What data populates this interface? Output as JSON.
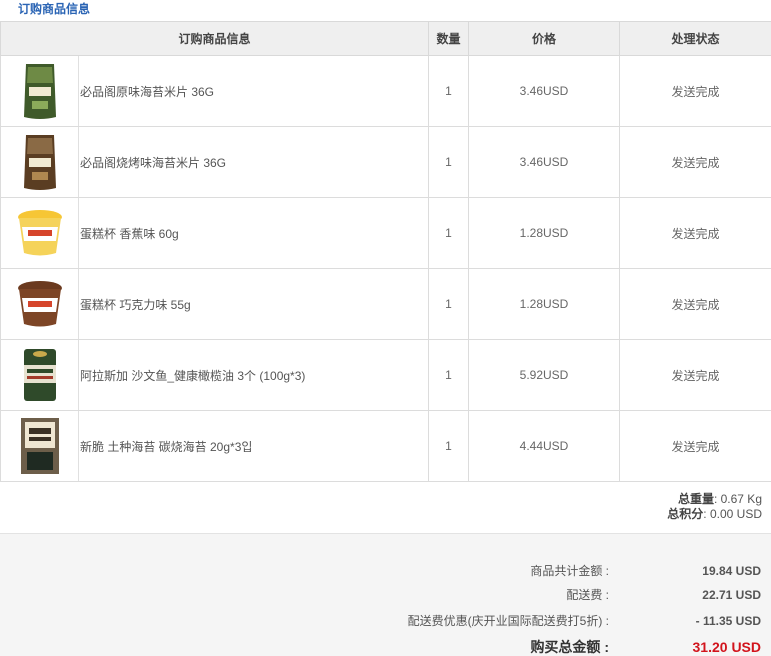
{
  "section_title": "订购商品信息",
  "columns": {
    "product": "订购商品信息",
    "quantity": "数量",
    "price": "价格",
    "status": "处理状态"
  },
  "items": [
    {
      "name": "必品阁原味海苔米片 36G",
      "qty": "1",
      "price": "3.46USD",
      "status": "发送完成",
      "icon": "green-seaweed-snack-bag-icon"
    },
    {
      "name": "必品阁烧烤味海苔米片 36G",
      "qty": "1",
      "price": "3.46USD",
      "status": "发送完成",
      "icon": "brown-seaweed-snack-bag-icon"
    },
    {
      "name": "蛋糕杯 香蕉味 60g",
      "qty": "1",
      "price": "1.28USD",
      "status": "发送完成",
      "icon": "yellow-cake-cup-icon"
    },
    {
      "name": "蛋糕杯 巧克力味 55g",
      "qty": "1",
      "price": "1.28USD",
      "status": "发送完成",
      "icon": "chocolate-cake-cup-icon"
    },
    {
      "name": "阿拉斯加 沙文鱼_健康橄榄油 3个 (100g*3)",
      "qty": "1",
      "price": "5.92USD",
      "status": "发送完成",
      "icon": "salmon-can-icon"
    },
    {
      "name": "新脆 土种海苔 碳烧海苔 20g*3입",
      "qty": "1",
      "price": "4.44USD",
      "status": "发送完成",
      "icon": "laver-pack-icon"
    }
  ],
  "weights": {
    "weight_label": "总重量",
    "weight_value": ": 0.67 Kg",
    "points_label": "总积分",
    "points_value": ": 0.00 USD"
  },
  "summary": {
    "subtotal_label": "商品共计金额 :",
    "subtotal_value": "19.84 USD",
    "shipping_label": "配送费 :",
    "shipping_value": "22.71 USD",
    "discount_label": "配送费优惠(庆开业国际配送费打5折) :",
    "discount_value": "- 11.35 USD",
    "total_label": "购买总金额 :",
    "total_value": "31.20 USD"
  },
  "colors": {
    "title_blue": "#2a64b4",
    "total_red": "#d2141c",
    "header_gray": "#efefef"
  }
}
